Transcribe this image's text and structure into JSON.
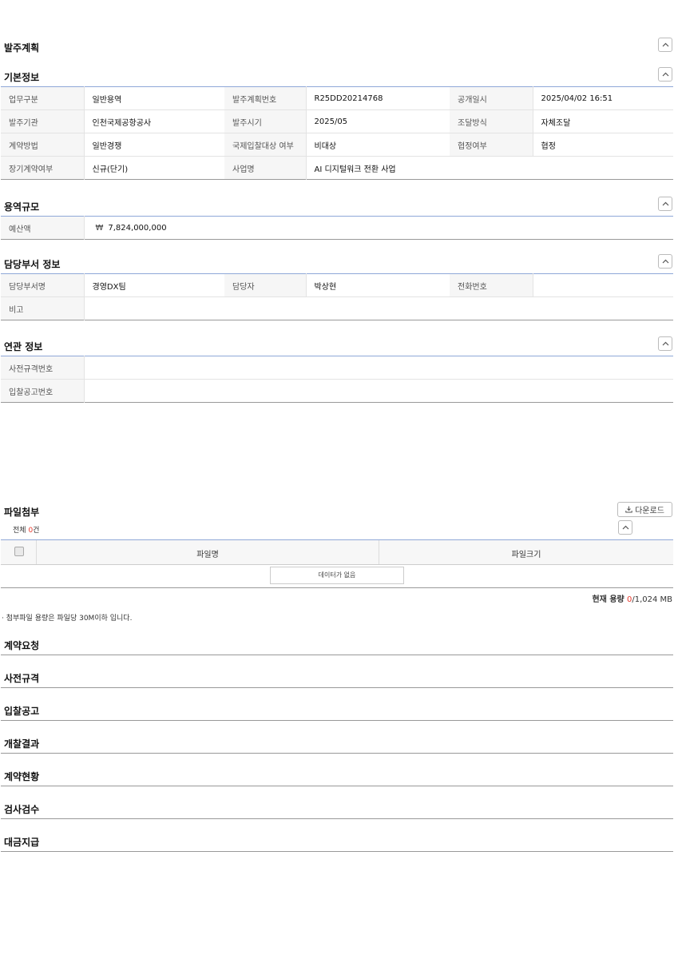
{
  "order_plan": {
    "title": "발주계획"
  },
  "basic_info": {
    "title": "기본정보",
    "rows": [
      [
        {
          "label": "업무구분",
          "value": "일반용역"
        },
        {
          "label": "발주계획번호",
          "value": "R25DD20214768"
        },
        {
          "label": "공개일시",
          "value": "2025/04/02 16:51"
        }
      ],
      [
        {
          "label": "발주기관",
          "value": "인천국제공항공사"
        },
        {
          "label": "발주시기",
          "value": "2025/05"
        },
        {
          "label": "조달방식",
          "value": "자체조달"
        }
      ],
      [
        {
          "label": "계약방법",
          "value": "일반경쟁"
        },
        {
          "label": "국제입찰대상 여부",
          "value": "비대상"
        },
        {
          "label": "협정여부",
          "value": "협정"
        }
      ],
      [
        {
          "label": "장기계약여부",
          "value": "신규(단기)"
        },
        {
          "label": "사업명",
          "value": "AI 디지털워크 전환 사업"
        }
      ]
    ]
  },
  "service_scale": {
    "title": "용역규모",
    "budget_label": "예산액",
    "budget_currency": "₩",
    "budget_value": "7,824,000,000"
  },
  "dept_info": {
    "title": "담당부서 정보",
    "dept_label": "담당부서명",
    "dept_value": "경영DX팀",
    "manager_label": "담당자",
    "manager_value": "박상현",
    "phone_label": "전화번호",
    "phone_value": "",
    "note_label": "비고",
    "note_value": ""
  },
  "related_info": {
    "title": "연관 정보",
    "pre_spec_label": "사전규격번호",
    "pre_spec_value": "",
    "bid_notice_label": "입찰공고번호",
    "bid_notice_value": ""
  },
  "attachments": {
    "title": "파일첨부",
    "download_label": "다운로드",
    "total_prefix": "전체",
    "total_count": "0",
    "total_suffix": "건",
    "col_filename": "파일명",
    "col_filesize": "파일크기",
    "empty_label": "데이터가 없음",
    "usage_prefix": "현재 용량",
    "usage_current": "0",
    "usage_sep": "/",
    "usage_max": "1,024 MB",
    "notice": "· 첨부파일 용량은 파일당 30M이하 입니다."
  },
  "sections": [
    "계약요청",
    "사전규격",
    "입찰공고",
    "개찰결과",
    "계약현황",
    "검사검수",
    "대금지급"
  ],
  "colors": {
    "accent_line": "#8fa8d8",
    "count_red": "#e8382b"
  }
}
